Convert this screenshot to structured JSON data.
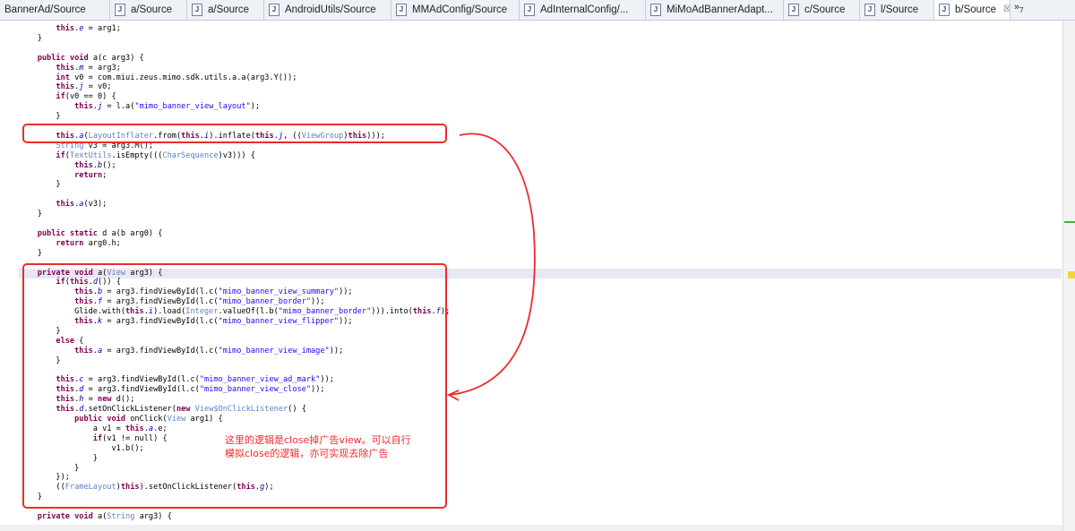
{
  "tabs": [
    {
      "label": "BannerAd/Source",
      "icon": "none"
    },
    {
      "label": "a/Source",
      "icon": "java-file-icon"
    },
    {
      "label": "a/Source",
      "icon": "java-file-icon"
    },
    {
      "label": "AndroidUtils/Source",
      "icon": "java-file-icon"
    },
    {
      "label": "MMAdConfig/Source",
      "icon": "java-file-icon"
    },
    {
      "label": "AdInternalConfig/...",
      "icon": "java-file-icon"
    },
    {
      "label": "MiMoAdBannerAdapt...",
      "icon": "java-file-icon"
    },
    {
      "label": "c/Source",
      "icon": "java-file-icon"
    },
    {
      "label": "l/Source",
      "icon": "java-file-icon"
    },
    {
      "label": "b/Source",
      "icon": "java-file-icon",
      "active": true,
      "close": "☒"
    }
  ],
  "tab_overflow": {
    "symbol": "»",
    "count": "7"
  },
  "icons": {
    "java_file": "J"
  },
  "colors": {
    "keyword": "#7f0055",
    "string": "#2a00ff",
    "field": "#0000c0",
    "type": "#5c7fc7",
    "annotation": "#ee2b2b"
  },
  "annotation_text": "这里的逻辑是close掉广告view。可以自行\n模拟close的逻辑，亦可实现去除广告",
  "code_lines": [
    "        this.e = arg1;",
    "    }",
    "",
    "    public void a(c arg3) {",
    "        this.m = arg3;",
    "        int v0 = com.miui.zeus.mimo.sdk.utils.a.a(arg3.Y());",
    "        this.j = v0;",
    "        if(v0 == 0) {",
    "            this.j = l.a(\"mimo_banner_view_layout\");",
    "        }",
    "",
    "        this.a(LayoutInflater.from(this.i).inflate(this.j, ((ViewGroup)this)));",
    "        String v3 = arg3.M();",
    "        if(TextUtils.isEmpty(((CharSequence)v3))) {",
    "            this.b();",
    "            return;",
    "        }",
    "",
    "        this.a(v3);",
    "    }",
    "",
    "    public static d a(b arg0) {",
    "        return arg0.h;",
    "    }",
    "",
    "    private void a(View arg3) {",
    "        if(this.d()) {",
    "            this.b = arg3.findViewById(l.c(\"mimo_banner_view_summary\"));",
    "            this.f = arg3.findViewById(l.c(\"mimo_banner_border\"));",
    "            Glide.with(this.i).load(Integer.valueOf(l.b(\"mimo_banner_border\"))).into(this.f);",
    "            this.k = arg3.findViewById(l.c(\"mimo_banner_view_flipper\"));",
    "        }",
    "        else {",
    "            this.a = arg3.findViewById(l.c(\"mimo_banner_view_image\"));",
    "        }",
    "",
    "        this.c = arg3.findViewById(l.c(\"mimo_banner_view_ad_mark\"));",
    "        this.d = arg3.findViewById(l.c(\"mimo_banner_view_close\"));",
    "        this.h = new d();",
    "        this.d.setOnClickListener(new View$OnClickListener() {",
    "            public void onClick(View arg1) {",
    "                a v1 = this.a.e;",
    "                if(v1 != null) {",
    "                    v1.b();",
    "                }",
    "            }",
    "        });",
    "        ((FrameLayout)this).setOnClickListener(this.g);",
    "    }",
    "",
    "    private void a(String arg3) {"
  ]
}
